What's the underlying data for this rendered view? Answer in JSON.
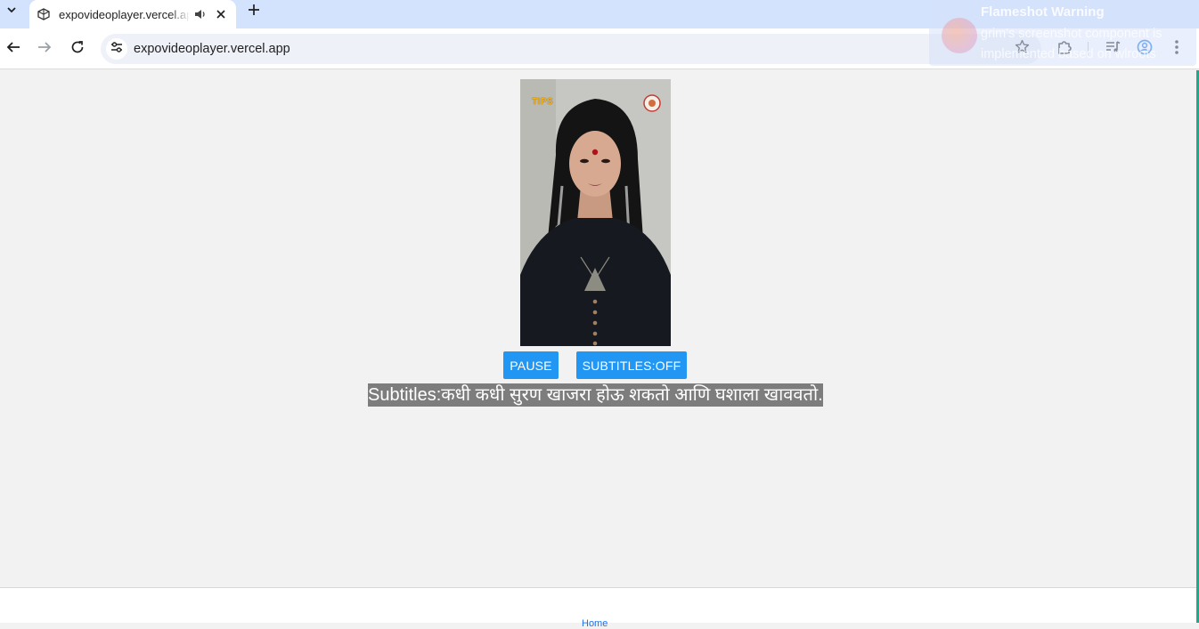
{
  "browser": {
    "tab": {
      "title": "expovideoplayer.vercel.app"
    },
    "address_bar": {
      "url": "expovideoplayer.vercel.app"
    },
    "accent": "#1a73e8"
  },
  "notification": {
    "title": "Flameshot Warning",
    "body": "grim's screenshot component is implemented based on wlroots"
  },
  "video": {
    "watermark": "TIPS"
  },
  "controls": {
    "pause_label": "PAUSE",
    "subtitles_label": "SUBTITLES:OFF",
    "button_color": "#2196f3"
  },
  "subtitle": {
    "text": "Subtitles:कधी कधी सुरण खाजरा होऊ शकतो आणि घशाला खाववतो."
  },
  "footer": {
    "home_link": "Home"
  }
}
